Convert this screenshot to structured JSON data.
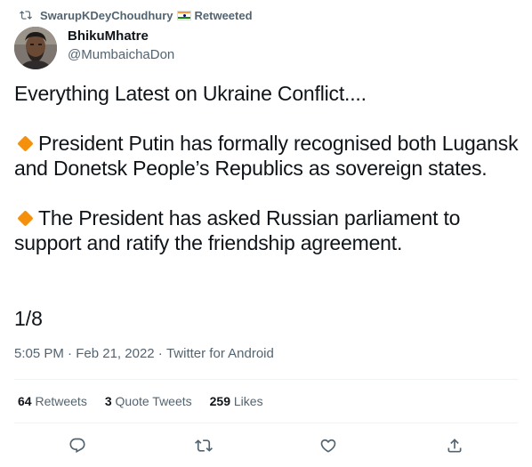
{
  "retweet": {
    "icon": "retweet-icon",
    "name": "SwarupKDeyChoudhury",
    "flag": "india-flag-icon",
    "label": "Retweeted"
  },
  "author": {
    "name": "BhikuMhatre",
    "handle": "@MumbaichaDon",
    "avatar": "avatar-photo"
  },
  "tweet": {
    "line1": "Everything Latest on Ukraine Conflict....",
    "point1": "President Putin has formally recognised both Lugansk and Donetsk People’s Republics as sovereign states.",
    "point2": "The President has asked Russian parliament to support and ratify the friendship agreement.",
    "thread": "1/8"
  },
  "meta": {
    "time": "5:05 PM",
    "sep": " · ",
    "date": "Feb 21, 2022",
    "source": "Twitter for Android"
  },
  "stats": {
    "retweets_count": "64",
    "retweets_label": " Retweets",
    "quotes_count": "3",
    "quotes_label": " Quote Tweets",
    "likes_count": "259",
    "likes_label": " Likes"
  },
  "actions": [
    "reply-icon",
    "retweet-icon",
    "like-icon",
    "share-icon"
  ],
  "colors": {
    "text": "#0f1419",
    "secondary": "#536471",
    "divider": "#eff3f4",
    "diamond": "#f4900c"
  }
}
